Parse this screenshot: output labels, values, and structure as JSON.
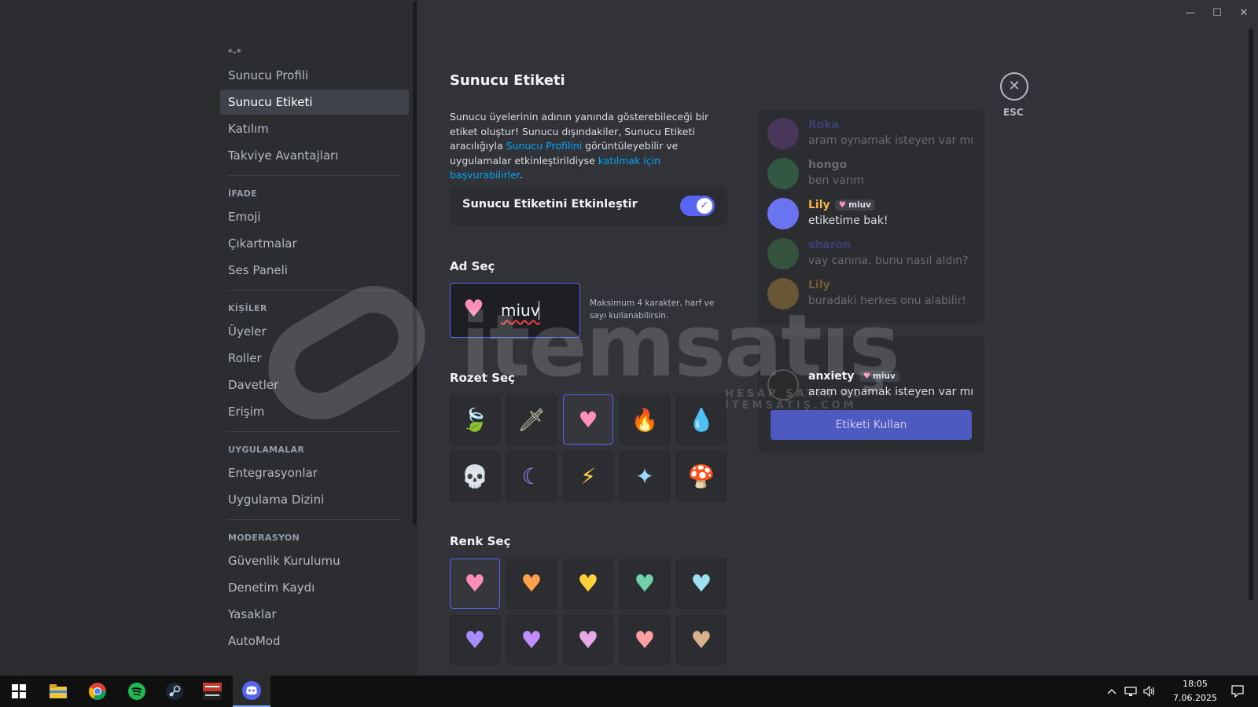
{
  "window_controls": {
    "minimize": "—",
    "maximize": "☐",
    "close": "✕"
  },
  "sidebar": {
    "server_label": "*-*",
    "groups": [
      {
        "title": "",
        "items": [
          "Sunucu Profili",
          "Sunucu Etiketi",
          "Katılım",
          "Takviye Avantajları"
        ]
      },
      {
        "title": "İFADE",
        "items": [
          "Emoji",
          "Çıkartmalar",
          "Ses Paneli"
        ]
      },
      {
        "title": "KİŞİLER",
        "items": [
          "Üyeler",
          "Roller",
          "Davetler",
          "Erişim"
        ]
      },
      {
        "title": "UYGULAMALAR",
        "items": [
          "Entegrasyonlar",
          "Uygulama Dizini"
        ]
      },
      {
        "title": "MODERASYON",
        "items": [
          "Güvenlik Kurulumu",
          "Denetim Kaydı",
          "Yasaklar",
          "AutoMod"
        ]
      }
    ],
    "active_item": "Sunucu Etiketi"
  },
  "main": {
    "title": "Sunucu Etiketi",
    "description_part1": "Sunucu üyelerinin adının yanında gösterebileceği bir etiket oluştur! Sunucu dışındakiler, Sunucu Etiketi aracılığıyla ",
    "description_link1": "Sunucu Profilini",
    "description_part2": " görüntüleyebilir ve uygulamalar etkinleştirildiyse ",
    "description_link2": "katılmak için başvurabilirler",
    "description_part3": ".",
    "enable_label": "Sunucu Etiketini Etkinleştir",
    "enable_toggle_on": true,
    "toggle_check": "✓",
    "name_section_title": "Ad Seç",
    "name_value": "miuv",
    "name_hint": "Maksimum 4 karakter, harf ve sayı kullanabilirsin.",
    "badge_section_title": "Rozet Seç",
    "badges": [
      {
        "icon": "leaf-icon",
        "glyph": "🍃",
        "color": "#5fbf3a"
      },
      {
        "icon": "sword-icon",
        "glyph": "🗡",
        "color": "#d8d2b8"
      },
      {
        "icon": "heart-icon",
        "glyph": "♥",
        "color": "#ff8fb8",
        "selected": true
      },
      {
        "icon": "fire-icon",
        "glyph": "🔥",
        "color": "#ff7a2e"
      },
      {
        "icon": "water-drop-icon",
        "glyph": "💧",
        "color": "#3fb6f0"
      },
      {
        "icon": "skull-icon",
        "glyph": "💀",
        "color": "#e6e6e6"
      },
      {
        "icon": "moon-icon",
        "glyph": "☾",
        "color": "#9b8cff"
      },
      {
        "icon": "lightning-icon",
        "glyph": "⚡",
        "color": "#ffd23c"
      },
      {
        "icon": "sparkle-icon",
        "glyph": "✦",
        "color": "#9fd8ff"
      },
      {
        "icon": "mushroom-icon",
        "glyph": "🍄",
        "color": "#e43b4a"
      }
    ],
    "color_section_title": "Renk Seç",
    "colors": [
      {
        "name": "pink",
        "hex": "#ff8fb8",
        "selected": true
      },
      {
        "name": "orange",
        "hex": "#ffa04d"
      },
      {
        "name": "yellow",
        "hex": "#ffd23c"
      },
      {
        "name": "teal",
        "hex": "#6fd1a8"
      },
      {
        "name": "light-blue",
        "hex": "#9fe0f0"
      },
      {
        "name": "lavender",
        "hex": "#a98cff"
      },
      {
        "name": "purple",
        "hex": "#c08cff"
      },
      {
        "name": "light-pink",
        "hex": "#e6a8e6"
      },
      {
        "name": "salmon",
        "hex": "#ff9f9f"
      },
      {
        "name": "tan",
        "hex": "#d9b08c"
      }
    ]
  },
  "preview": {
    "messages": [
      {
        "name": "Roka",
        "text": "aram oynamak isteyen var mı",
        "name_color": "#5865f2",
        "avatar": "#7d4aa8",
        "dim": true
      },
      {
        "name": "hongo",
        "text": "ben varım",
        "name_color": "#dbdee1",
        "avatar": "#3fa86b",
        "dim": true
      },
      {
        "name": "Lily",
        "text": "etiketime bak!",
        "name_color": "#ffb347",
        "avatar": "#6a74f0",
        "dim": false,
        "tag": "miuv"
      },
      {
        "name": "sharon",
        "text": "vay canına, bunu nasıl aldın?",
        "name_color": "#5865f2",
        "avatar": "#4a9a5a",
        "dim": true
      },
      {
        "name": "Lily",
        "text": "buradaki herkes onu alabilir!",
        "name_color": "#ffb347",
        "avatar": "#d9a23c",
        "dim": true
      }
    ],
    "self": {
      "name": "anxiety",
      "tag": "miuv",
      "text": "aram oynamak isteyen var mı"
    },
    "use_tag_button": "Etiketi Kullan"
  },
  "close": {
    "icon": "✕",
    "label": "ESC"
  },
  "watermark": {
    "text": "itemsatış",
    "sub": "HESAP SATIN AL · İTEMSATIŞ.COM"
  },
  "taskbar": {
    "apps": [
      "windows-start-icon",
      "file-explorer-icon",
      "chrome-icon",
      "spotify-icon",
      "steam-icon",
      "voicemeeter-icon",
      "discord-icon"
    ],
    "time": "18:05",
    "date": "7.06.2025"
  }
}
